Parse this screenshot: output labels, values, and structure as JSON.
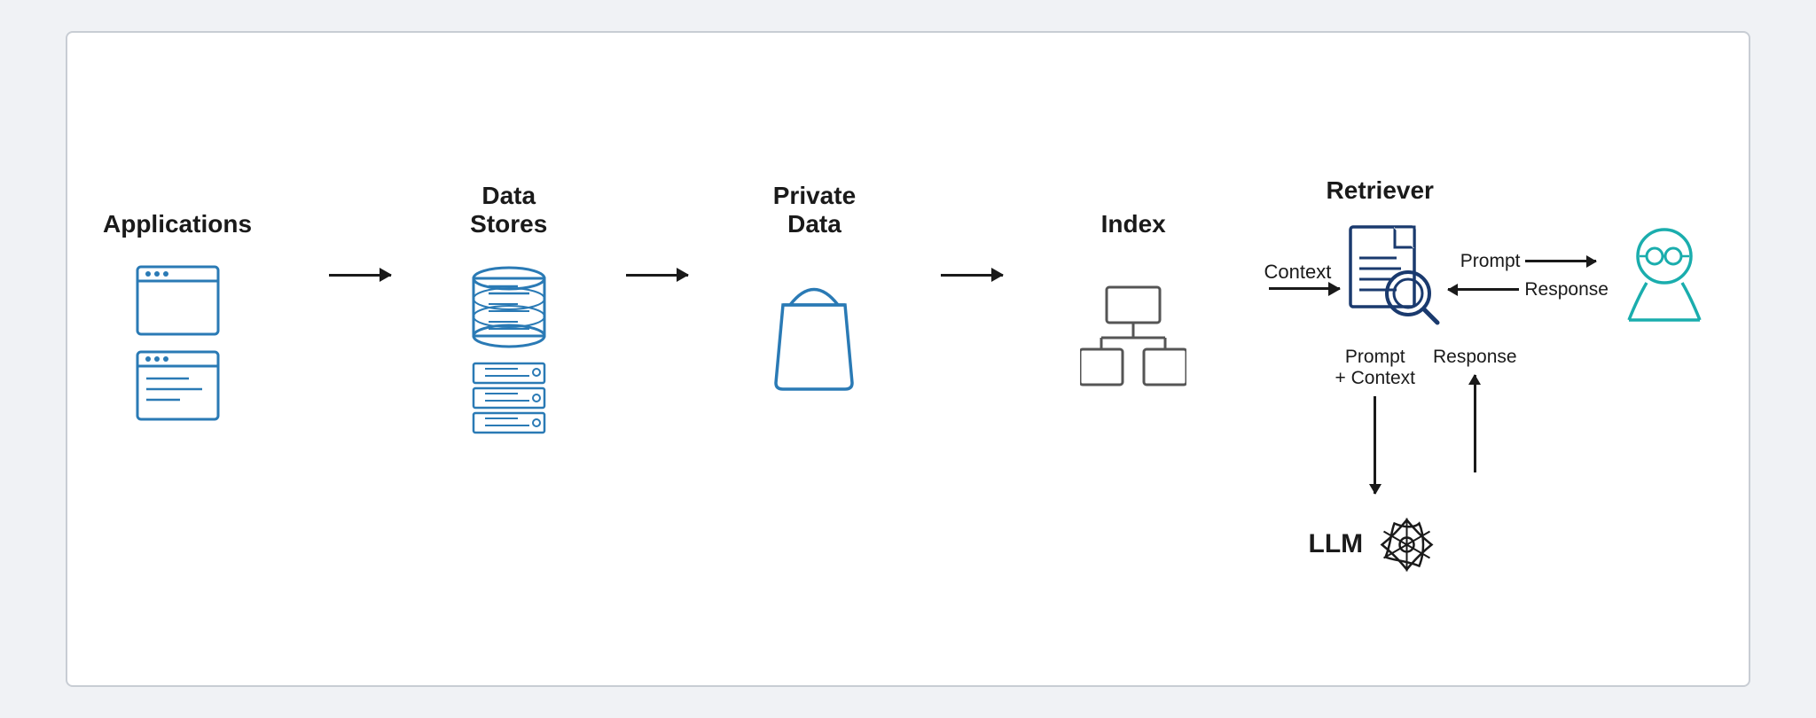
{
  "sections": {
    "applications": {
      "label": "Applications"
    },
    "dataStores": {
      "label": "Data\nStores"
    },
    "privateData": {
      "label": "Private\nData"
    },
    "index": {
      "label": "Index"
    },
    "retriever": {
      "label": "Retriever"
    }
  },
  "arrows": {
    "context": "Context",
    "prompt": "Prompt",
    "response": "Response",
    "promptContext": "Prompt\n+ Context"
  },
  "llm": {
    "label": "LLM"
  },
  "colors": {
    "blue": "#2a7ab5",
    "teal": "#1aadad",
    "dark": "#1a1a2e",
    "black": "#1a1a1a",
    "openai": "#1a1a1a"
  }
}
